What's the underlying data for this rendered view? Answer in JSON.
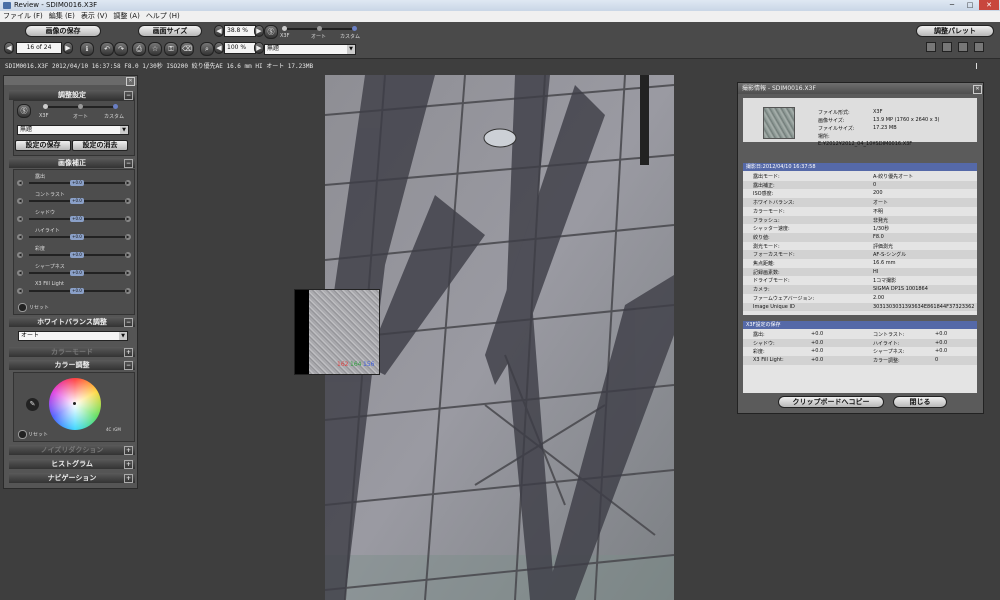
{
  "window": {
    "title": "Review - SDIM0016.X3F",
    "min": "─",
    "max": "□",
    "close": "✕"
  },
  "menu": [
    "ファイル (F)",
    "編集 (E)",
    "表示 (V)",
    "調整 (A)",
    "ヘルプ (H)"
  ],
  "toolbar": {
    "save_label": "画像の保存",
    "screen_size_label": "画面サイズ",
    "adjust_palette_label": "調整パレット",
    "page_value": "16 of 24",
    "zoom1": "38.8 %",
    "zoom2": "100 %",
    "mode_x3f": "X3F",
    "mode_auto": "オート",
    "mode_custom": "カスタム",
    "preset_value": "無題"
  },
  "info_strip": "SDIM0016.X3F 2012/04/10 16:37:58 F8.0 1/30秒 ISO200 絞り優先AE 16.6 mm HI オート 17.23MB",
  "left_panel": {
    "adjust_settings_title": "調整設定",
    "mode_x3f": "X3F",
    "mode_auto": "オート",
    "mode_custom": "カスタム",
    "preset_value": "無題",
    "save_setting": "設定の保存",
    "delete_setting": "設定の消去",
    "image_correction_title": "画像補正",
    "sliders": [
      {
        "label": "露出",
        "value": "+0.0"
      },
      {
        "label": "コントラスト",
        "value": "+0.0"
      },
      {
        "label": "シャドウ",
        "value": "+0.0"
      },
      {
        "label": "ハイライト",
        "value": "+0.0"
      },
      {
        "label": "彩度",
        "value": "+0.0"
      },
      {
        "label": "シャープネス",
        "value": "+0.0"
      },
      {
        "label": "X3 Fill Light",
        "value": "+0.0"
      }
    ],
    "reset_label": "リセット",
    "wb_title": "ホワイトバランス調整",
    "wb_value": "オート",
    "color_mode_title": "カラーモード",
    "color_adjust_title": "カラー調整",
    "color_reset": "リセット",
    "color_small": "4C rGM",
    "noise_title": "ノイズリダクション",
    "histogram_title": "ヒストグラム",
    "navigation_title": "ナビゲーション"
  },
  "zoom_readout": {
    "r": "162",
    "g": "164",
    "b": "156"
  },
  "right_panel": {
    "title": "撮影情報 - SDIM0016.X3F",
    "file_format_label": "ファイル形式:",
    "file_format": "X3F",
    "image_size_label": "画像サイズ:",
    "image_size": "13.9 MP (1760 x 2640 x 3)",
    "file_size_label": "ファイルサイズ:",
    "file_size": "17.23 MB",
    "location_label": "場所:",
    "location": "E:¥2012¥2012_04_10¥SDIM0016.X3F",
    "shoot_header": "撮影日:2012/04/10 16:37:58",
    "shoot_rows": [
      {
        "k": "露出モード:",
        "v": "A-絞り優先オート"
      },
      {
        "k": "露出補正:",
        "v": "0"
      },
      {
        "k": "ISO感度:",
        "v": "200"
      },
      {
        "k": "ホワイトバランス:",
        "v": "オート"
      },
      {
        "k": "カラーモード:",
        "v": "不明"
      },
      {
        "k": "フラッシュ:",
        "v": "非発光"
      },
      {
        "k": "シャッター速度:",
        "v": "1/30秒"
      },
      {
        "k": "絞り値:",
        "v": "F8.0"
      },
      {
        "k": "測光モード:",
        "v": "評価測光"
      },
      {
        "k": "フォーカスモード:",
        "v": "AF-S-シングル"
      },
      {
        "k": "焦点距離:",
        "v": "16.6 mm"
      },
      {
        "k": "記録画素数:",
        "v": "HI"
      },
      {
        "k": "ドライブモード:",
        "v": "1コマ撮影"
      },
      {
        "k": "カメラ:",
        "v": "SIGMA DP1S 1001864"
      },
      {
        "k": "ファームウェアバージョン:",
        "v": "2.00"
      },
      {
        "k": "Image Unique ID",
        "v": "3031303031393634E861844F37323362"
      }
    ],
    "x3f_header": "X3F設定の保存",
    "x3f_rows": [
      {
        "k1": "露出:",
        "v1": "+0.0",
        "k2": "コントラスト:",
        "v2": "+0.0"
      },
      {
        "k1": "シャドウ:",
        "v1": "+0.0",
        "k2": "ハイライト:",
        "v2": "+0.0"
      },
      {
        "k1": "彩度:",
        "v1": "+0.0",
        "k2": "シャープネス:",
        "v2": "+0.0"
      },
      {
        "k1": "X3 Fill Light:",
        "v1": "+0.0",
        "k2": "カラー調整:",
        "v2": "0"
      }
    ],
    "copy_button": "クリップボードへコピー",
    "close_button": "閉じる"
  },
  "colors": {
    "accent": "#5569a8",
    "panel": "#555555",
    "bg": "#3e3e3e"
  }
}
